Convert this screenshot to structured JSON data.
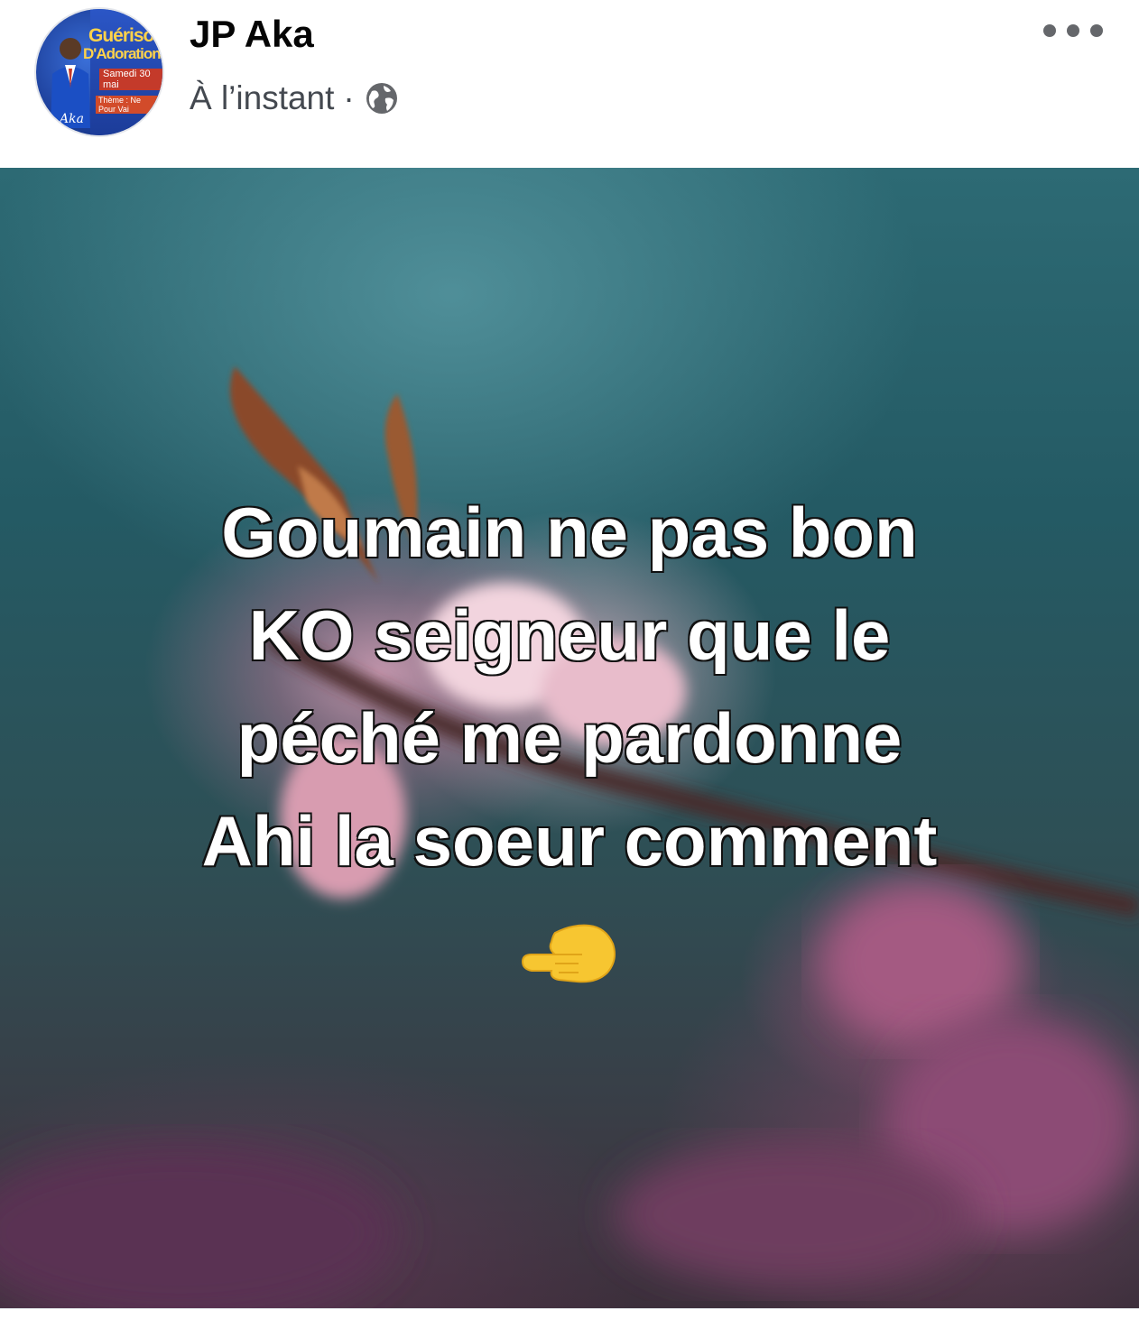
{
  "author": {
    "name": "JP Aka",
    "avatar_texts": {
      "line1": "Guériso",
      "line2": "D'Adoration",
      "line3": "Samedi 30 mai",
      "line4": "Thème : Ne Pour Vai",
      "signature": "Aka"
    }
  },
  "post_meta": {
    "timestamp": "À l’instant",
    "separator": "·",
    "audience_icon": "globe-icon"
  },
  "menu": {
    "icon": "more-options-icon"
  },
  "image": {
    "caption_lines": [
      "Goumain ne pas bon",
      "KO seigneur que le",
      "péché me pardonne",
      "Ahi la soeur comment"
    ],
    "emoji": "backhand-index-pointing-left-emoji"
  },
  "colors": {
    "name_text": "#050505",
    "meta_text": "#444950",
    "caption_fill": "#ffffff",
    "caption_outline": "#111111"
  }
}
